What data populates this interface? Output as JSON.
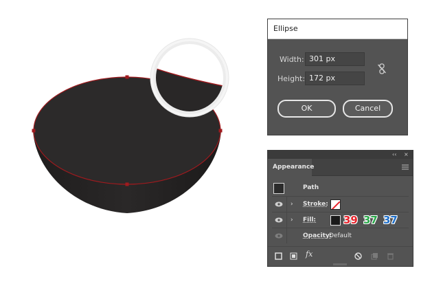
{
  "dialog": {
    "title": "Ellipse",
    "width_label": "Width:",
    "width_value": "301 px",
    "height_label": "Height:",
    "height_value": "172 px",
    "ok_label": "OK",
    "cancel_label": "Cancel",
    "link_icon": "unlink-icon"
  },
  "panel": {
    "collapse_glyph": "‹‹",
    "close_glyph": "×",
    "tab_label": "Appearance",
    "path_label": "Path",
    "stroke_label": "Stroke:",
    "fill_label": "Fill:",
    "opacity_label": "Opacity:",
    "opacity_value": "Default",
    "fx_label": "fx",
    "fill_rgb": {
      "r": "39",
      "g": "37",
      "b": "37",
      "r_color": "#e8232b",
      "g_color": "#2aa84a",
      "b_color": "#1f6fc9"
    },
    "bottom_icons": [
      "new-stroke-icon",
      "new-fill-icon",
      "fx-icon",
      "clear-appearance-icon",
      "duplicate-item-icon",
      "delete-item-icon"
    ]
  },
  "colors": {
    "bowl_fill": "#272525",
    "path_color": "#a01a1e",
    "panel_bg": "#535353"
  }
}
